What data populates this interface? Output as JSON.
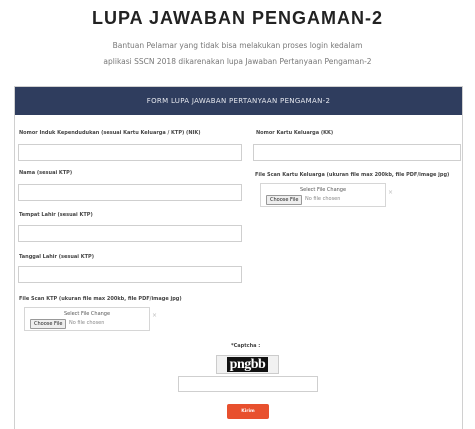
{
  "page": {
    "title": "LUPA JAWABAN PENGAMAN-2",
    "subtitle_line1": "Bantuan Pelamar yang tidak bisa melakukan proses login kedalam",
    "subtitle_line2": "aplikasi SSCN 2018 dikarenakan lupa Jawaban Pertanyaan Pengaman-2"
  },
  "form": {
    "header": "FORM LUPA JAWABAN PERTANYAAN PENGAMAN-2",
    "fields": {
      "nik": {
        "label": "Nomor Induk Kependudukan (sesuai Kartu Keluarga / KTP) (NIK)",
        "value": ""
      },
      "kk": {
        "label": "Nomor Kartu Keluarga (KK)",
        "value": ""
      },
      "nama": {
        "label": "Nama (sesuai KTP)",
        "value": ""
      },
      "tempat_lahir": {
        "label": "Tempat Lahir (sesuai KTP)",
        "value": ""
      },
      "tanggal_lahir": {
        "label": "Tanggal Lahir (sesuai KTP)",
        "value": ""
      },
      "file_kk": {
        "label": "File Scan Kartu Keluarga (ukuran file max 200kb, file PDF/image jpg)",
        "drop_label": "Select File Change",
        "button_label": "Choose File",
        "status": "No file chosen"
      },
      "file_ktp": {
        "label": "File Scan KTP (ukuran file max 200kb, file PDF/image jpg)",
        "drop_label": "Select File Change",
        "button_label": "Choose File",
        "status": "No file chosen"
      }
    },
    "captcha": {
      "label": "*Captcha :",
      "image_text": "pngbb",
      "input_value": ""
    },
    "submit_label": "Kirim"
  }
}
